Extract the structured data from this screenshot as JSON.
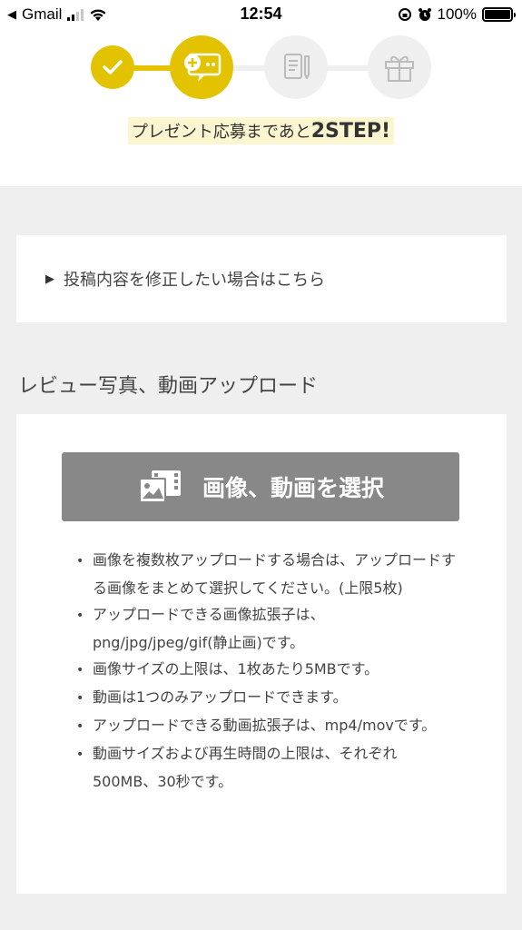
{
  "status_bar": {
    "back_label": "Gmail",
    "time": "12:54",
    "battery": "100%"
  },
  "progress": {
    "caption_prefix": "プレゼント応募まであと",
    "caption_step": "2STEP!",
    "accent_color": "#e3c300",
    "inactive_color": "#efefef",
    "steps": [
      {
        "name": "check-icon",
        "state": "done"
      },
      {
        "name": "chat-plus-icon",
        "state": "current"
      },
      {
        "name": "document-pencil-icon",
        "state": "todo"
      },
      {
        "name": "gift-icon",
        "state": "todo"
      }
    ]
  },
  "fix_link": {
    "label": "投稿内容を修正したい場合はこちら"
  },
  "upload_section": {
    "title": "レビュー写真、動画アップロード",
    "button_label": "画像、動画を選択",
    "button_icon": "photo-video-icon",
    "notes": [
      "画像を複数枚アップロードする場合は、アップロードする画像をまとめて選択してください。(上限5枚)",
      "アップロードできる画像拡張子は、png/jpg/jpeg/gif(静止画)です。",
      "画像サイズの上限は、1枚あたり5MBです。",
      "動画は1つのみアップロードできます。",
      "アップロードできる動画拡張子は、mp4/movです。",
      "動画サイズおよび再生時間の上限は、それぞれ500MB、30秒です。"
    ]
  }
}
